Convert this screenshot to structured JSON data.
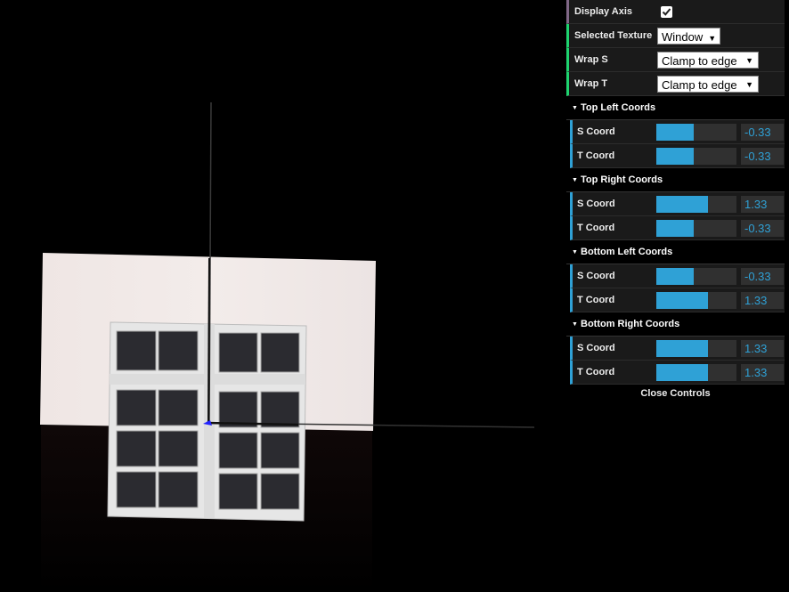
{
  "controls": {
    "display_axis": {
      "label": "Display Axis",
      "checked": true
    },
    "selected_texture": {
      "label": "Selected Texture",
      "value": "Window"
    },
    "wrap_s": {
      "label": "Wrap S",
      "value": "Clamp to edge"
    },
    "wrap_t": {
      "label": "Wrap T",
      "value": "Clamp to edge"
    },
    "folders": [
      {
        "title": "Top Left Coords",
        "s": {
          "label": "S Coord",
          "value": "-0.33",
          "fraction": 0.47
        },
        "t": {
          "label": "T Coord",
          "value": "-0.33",
          "fraction": 0.47
        }
      },
      {
        "title": "Top Right Coords",
        "s": {
          "label": "S Coord",
          "value": "1.33",
          "fraction": 0.64
        },
        "t": {
          "label": "T Coord",
          "value": "-0.33",
          "fraction": 0.47
        }
      },
      {
        "title": "Bottom Left Coords",
        "s": {
          "label": "S Coord",
          "value": "-0.33",
          "fraction": 0.47
        },
        "t": {
          "label": "T Coord",
          "value": "1.33",
          "fraction": 0.64
        }
      },
      {
        "title": "Bottom Right Coords",
        "s": {
          "label": "S Coord",
          "value": "1.33",
          "fraction": 0.64
        },
        "t": {
          "label": "T Coord",
          "value": "1.33",
          "fraction": 0.64
        }
      }
    ],
    "close_label": "Close Controls"
  },
  "colors": {
    "accent": "#2fa1d6",
    "panel_bg": "#1a1a1a",
    "wall": "#ede7e6",
    "window_frame": "#e8e8e8",
    "glass": "#2a2a2e"
  },
  "icons": {
    "check": "check-icon",
    "folder_toggle": "triangle-down-icon",
    "dropdown": "dropdown-arrow-icon"
  }
}
